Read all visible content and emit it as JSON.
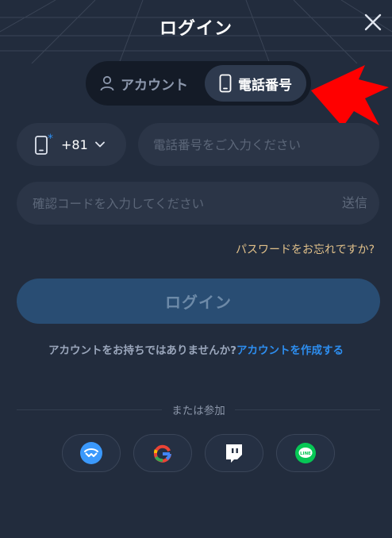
{
  "header": {
    "title": "ログイン",
    "close_icon": "close-icon"
  },
  "tabs": [
    {
      "label": "アカウント",
      "icon": "user-icon",
      "active": false
    },
    {
      "label": "電話番号",
      "icon": "mobile-phone-icon",
      "active": true
    }
  ],
  "form": {
    "country_code": "+81",
    "required_mark": "*",
    "phone_placeholder": "電話番号をご入力ください",
    "code_placeholder": "確認コードを入力してください",
    "send_label": "送信",
    "forgot_label": "パスワードをお忘れですか?",
    "login_label": "ログイン"
  },
  "signup": {
    "question": "アカウントをお持ちではありませんか?",
    "link": "アカウントを作成する"
  },
  "social": {
    "divider_label": "または参加",
    "providers": [
      {
        "icon": "walletconnect-icon"
      },
      {
        "icon": "google-icon"
      },
      {
        "icon": "twitch-icon"
      },
      {
        "icon": "line-icon",
        "text": "LINE"
      }
    ]
  },
  "colors": {
    "background": "#222c3d",
    "active_tab": "#2e3a4e",
    "field": "#2b3547",
    "primary_button": "#294d73",
    "link": "#2d8ef0",
    "forgot": "#e0c08a",
    "annotation_arrow": "#ff0000"
  }
}
